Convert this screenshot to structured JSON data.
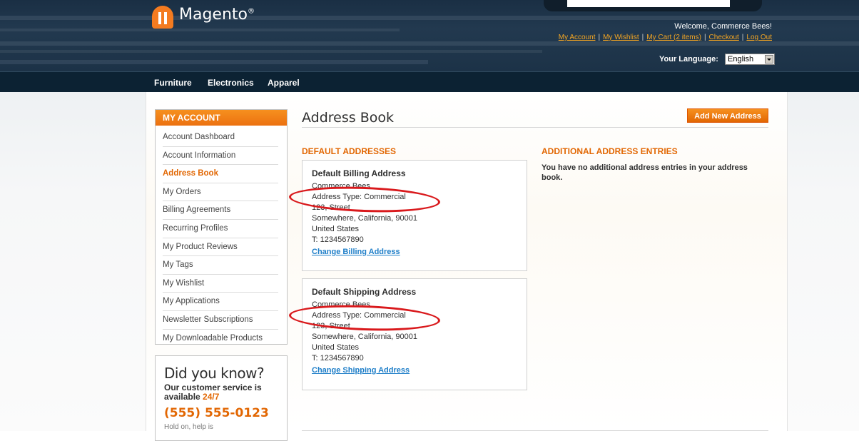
{
  "header": {
    "logo_text": "Magento",
    "logo_mark": "®",
    "welcome": "Welcome, Commerce Bees!",
    "links": [
      "My Account",
      "My Wishlist",
      "My Cart (2 items)",
      "Checkout",
      "Log Out"
    ],
    "language_label": "Your Language:",
    "language_value": "English"
  },
  "nav": {
    "items": [
      "Furniture",
      "Electronics",
      "Apparel"
    ]
  },
  "sidebar": {
    "title": "MY ACCOUNT",
    "items": [
      "Account Dashboard",
      "Account Information",
      "Address Book",
      "My Orders",
      "Billing Agreements",
      "Recurring Profiles",
      "My Product Reviews",
      "My Tags",
      "My Wishlist",
      "My Applications",
      "Newsletter Subscriptions",
      "My Downloadable Products"
    ],
    "active_index": 2,
    "did_you_know": {
      "title": "Did you know?",
      "text_1": "Our customer service is",
      "text_2": "available ",
      "text_hl": "24/7",
      "phone": "(555) 555-0123",
      "small": "Hold on, help is"
    }
  },
  "main": {
    "title": "Address Book",
    "add_button": "Add New Address",
    "default_title": "DEFAULT ADDRESSES",
    "additional_title": "ADDITIONAL ADDRESS ENTRIES",
    "no_entries": "You have no additional address entries in your address book.",
    "billing": {
      "heading": "Default Billing Address",
      "lines": [
        "Commerce Bees",
        "Address Type: Commercial",
        "123, Street",
        "Somewhere, California, 90001",
        "United States",
        "T: 1234567890"
      ],
      "link": "Change Billing Address"
    },
    "shipping": {
      "heading": "Default Shipping Address",
      "lines": [
        "Commerce Bees",
        "Address Type: Commercial",
        "123, Street",
        "Somewhere, California, 90001",
        "United States",
        "T: 1234567890"
      ],
      "link": "Change Shipping Address"
    }
  },
  "colors": {
    "accent": "#e26703",
    "link": "#1e7ec8",
    "header_bg": "#1c3247",
    "annotation": "#d9191c"
  }
}
